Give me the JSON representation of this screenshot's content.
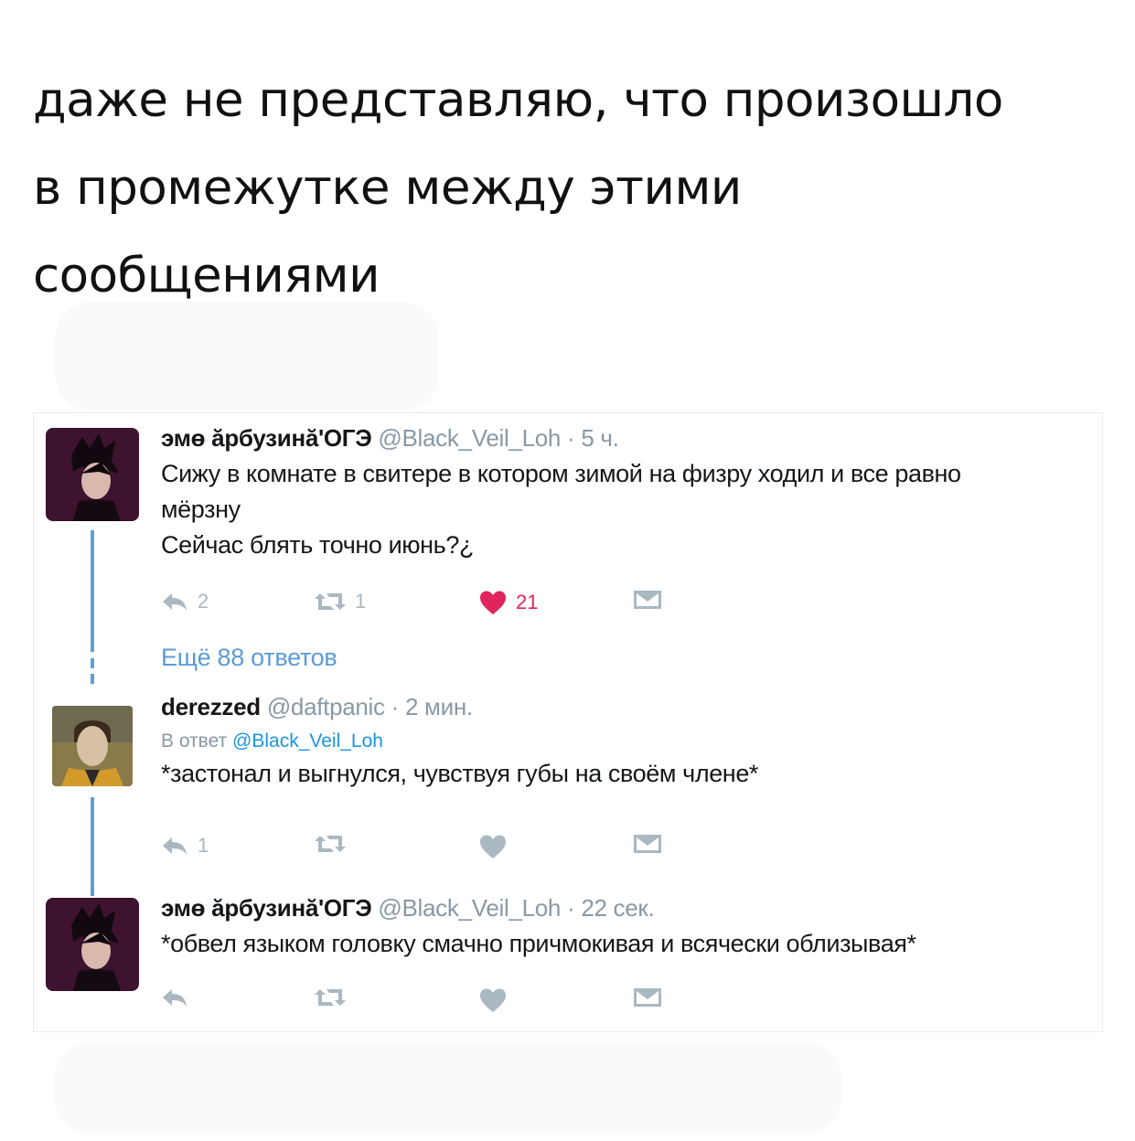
{
  "caption": {
    "lines": [
      "даже не представляю, что произошло",
      "в промежутке между этими",
      "сообщениями"
    ]
  },
  "tweets": [
    {
      "name": "эмө ӑрбузинӑ'ОГЭ",
      "handle": "@Black_Veil_Loh",
      "time": "· 5 ч.",
      "text_lines": [
        "Сижу в комнате в свитере в котором зимой на физру ходил и все равно",
        "мёрзну",
        "Сейчас блять точно июнь?¿"
      ],
      "replies": "2",
      "retweets": "1",
      "likes": "21",
      "liked": true
    },
    {
      "name": "derezzed",
      "handle": "@daftpanic",
      "time": "· 2 мин.",
      "reply_prefix": "В ответ",
      "reply_mention": "@Black_Veil_Loh",
      "text": "*застонал и выгнулся, чувствуя губы на своём члене*",
      "replies": "1"
    },
    {
      "name": "эмө ӑрбузинӑ'ОГЭ",
      "handle": "@Black_Veil_Loh",
      "time": "· 22 сек.",
      "text": "*обвел языком головку смачно причмокивая и всячески облизывая*"
    }
  ],
  "more_replies": "Ещё 88 ответов",
  "colors": {
    "thread_line": "#5f9ed4",
    "like_active": "#e0245e",
    "icon_gray": "#aab8c2",
    "link_blue": "#1b95e0"
  }
}
